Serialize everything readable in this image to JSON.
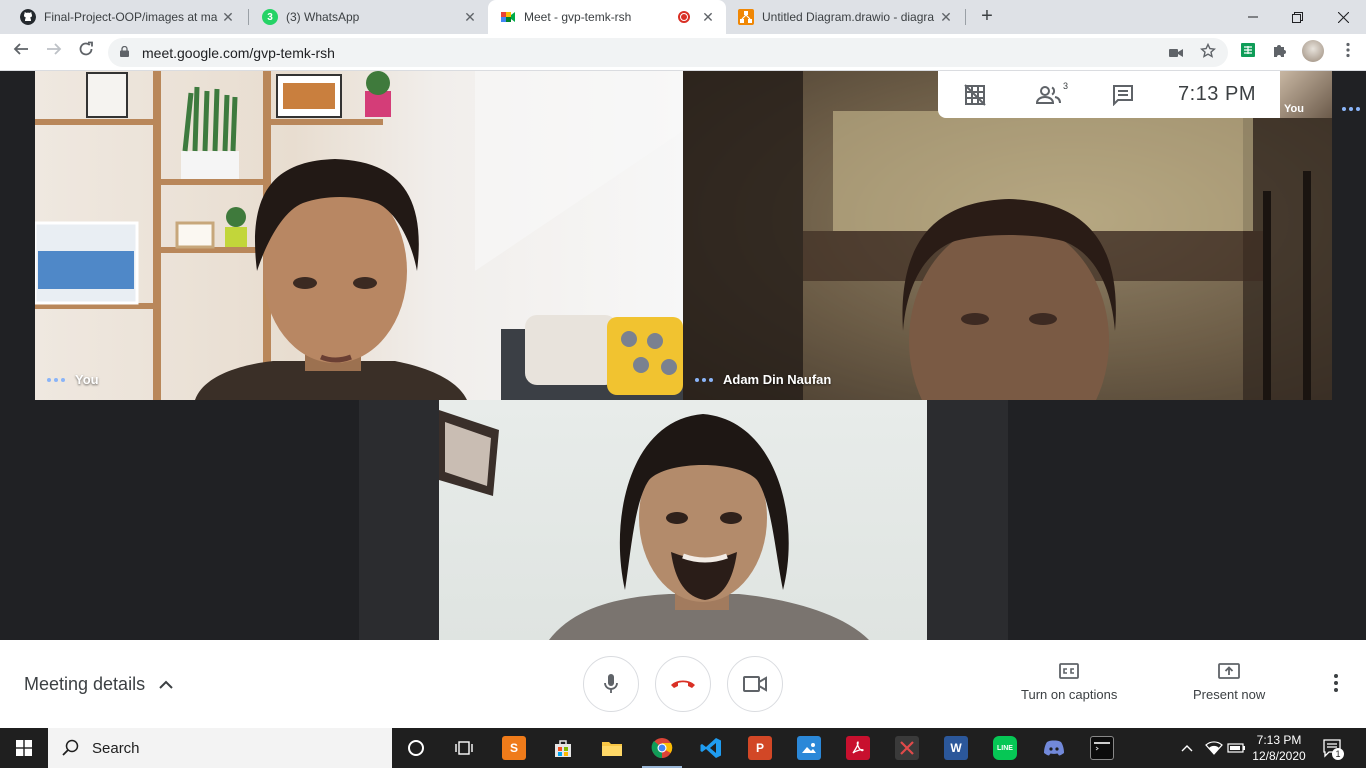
{
  "browser": {
    "tabs": [
      {
        "title": "Final-Project-OOP/images at ma",
        "icon": "github-icon"
      },
      {
        "title": "(3) WhatsApp",
        "icon": "whatsapp-icon"
      },
      {
        "title": "Meet - gvp-temk-rsh",
        "icon": "meet-icon"
      },
      {
        "title": "Untitled Diagram.drawio - diagra",
        "icon": "drawio-icon"
      }
    ],
    "whatsapp_badge": "3",
    "url": "meet.google.com/gvp-temk-rsh"
  },
  "meet": {
    "tiles": [
      {
        "name": "You"
      },
      {
        "name": "Adam Din Naufan"
      },
      {
        "name": ""
      }
    ],
    "participants_count": "3",
    "clock": "7:13  PM",
    "self_view_label": "You",
    "meeting_details": "Meeting details",
    "captions_label": "Turn on captions",
    "present_label": "Present now"
  },
  "taskbar": {
    "search_placeholder": "Search",
    "time": "7:13 PM",
    "date": "12/8/2020",
    "notification_count": "1"
  },
  "colors": {
    "meet_bg": "#202124",
    "accent_blue": "#8ab4f8",
    "hangup_red": "#d93025",
    "recording_red": "#d93025"
  }
}
